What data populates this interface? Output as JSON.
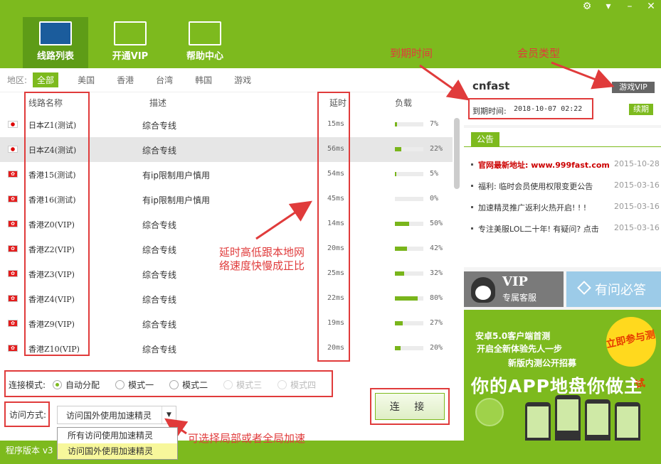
{
  "window": {
    "icons": [
      "gear-icon",
      "menu-icon",
      "minimize-icon",
      "close-icon"
    ]
  },
  "nav": {
    "tabs": [
      {
        "label": "线路列表",
        "icon": "server-list-icon"
      },
      {
        "label": "开通VIP",
        "icon": "cart-icon"
      },
      {
        "label": "帮助中心",
        "icon": "help-search-icon"
      }
    ]
  },
  "region": {
    "label": "地区:",
    "options": [
      "全部",
      "美国",
      "香港",
      "台湾",
      "韩国",
      "游戏"
    ],
    "selected": "全部"
  },
  "table": {
    "headers": {
      "name": "线路名称",
      "desc": "描述",
      "latency": "延时",
      "load": "负载"
    },
    "rows": [
      {
        "flag": "jp",
        "name": "日本Z1(测试)",
        "desc": "综合专线",
        "latency": "15ms",
        "load": 7
      },
      {
        "flag": "jp",
        "name": "日本Z4(测试)",
        "desc": "综合专线",
        "latency": "56ms",
        "load": 22
      },
      {
        "flag": "hk",
        "name": "香港15(测试)",
        "desc": "有ip限制用户慎用",
        "latency": "54ms",
        "load": 5
      },
      {
        "flag": "hk",
        "name": "香港16(测试)",
        "desc": "有ip限制用户慎用",
        "latency": "45ms",
        "load": 0
      },
      {
        "flag": "hk",
        "name": "香港Z0(VIP)",
        "desc": "综合专线",
        "latency": "14ms",
        "load": 50
      },
      {
        "flag": "hk",
        "name": "香港Z2(VIP)",
        "desc": "综合专线",
        "latency": "20ms",
        "load": 42
      },
      {
        "flag": "hk",
        "name": "香港Z3(VIP)",
        "desc": "综合专线",
        "latency": "25ms",
        "load": 32
      },
      {
        "flag": "hk",
        "name": "香港Z4(VIP)",
        "desc": "综合专线",
        "latency": "22ms",
        "load": 80
      },
      {
        "flag": "hk",
        "name": "香港Z9(VIP)",
        "desc": "综合专线",
        "latency": "19ms",
        "load": 27
      },
      {
        "flag": "hk",
        "name": "香港Z10(VIP)",
        "desc": "综合专线",
        "latency": "20ms",
        "load": 20
      }
    ],
    "highlighted_row": 1
  },
  "mode": {
    "label": "连接模式:",
    "options": [
      {
        "label": "自动分配",
        "state": "selected"
      },
      {
        "label": "模式一",
        "state": "enabled"
      },
      {
        "label": "模式二",
        "state": "enabled"
      },
      {
        "label": "模式三",
        "state": "disabled"
      },
      {
        "label": "模式四",
        "state": "disabled"
      }
    ]
  },
  "access": {
    "label": "访问方式:",
    "value": "访问国外使用加速精灵",
    "options": [
      "所有访问使用加速精灵",
      "访问国外使用加速精灵"
    ]
  },
  "connect_label": "连 接",
  "status": {
    "version_label": "程序版本 v3"
  },
  "account": {
    "username": "cnfast",
    "vip_type": "游戏VIP",
    "expiry_label": "到期时间:",
    "expiry": "2018-10-07 02:22",
    "renew_label": "续期"
  },
  "notice": {
    "tab": "公告",
    "items": [
      {
        "title": "官网最新地址: www.999fast.com",
        "date": "2015-10-28",
        "hot": true
      },
      {
        "title": "福利: 临时会员使用权限变更公告",
        "date": "2015-03-16",
        "hot": false
      },
      {
        "title": "加速精灵推广返利火热开启! ! !",
        "date": "2015-03-16",
        "hot": false
      },
      {
        "title": "专注美服LOL二十年! 有疑问? 点击",
        "date": "2015-03-16",
        "hot": false
      }
    ]
  },
  "promo": {
    "vip_big": "VIP",
    "vip_small": "专属客服",
    "qa": "有问必答"
  },
  "ad": {
    "line1": "安卓5.0客户端首测",
    "line2": "开启全新体验先人一步",
    "line3": "新版内测公开招募",
    "hero": "你的APP地盘你做主",
    "badge": "立即参与测试"
  },
  "annotations": {
    "expiry_time": "到期时间",
    "member_type": "会员类型",
    "latency_note_1": "延时高低跟本地网",
    "latency_note_2": "络速度快慢成正比",
    "access_note": "可选择局部或者全局加速"
  },
  "colors": {
    "brand_green": "#7dba1e",
    "annotation_red": "#e03b3b",
    "hot_red": "#cc0000"
  }
}
